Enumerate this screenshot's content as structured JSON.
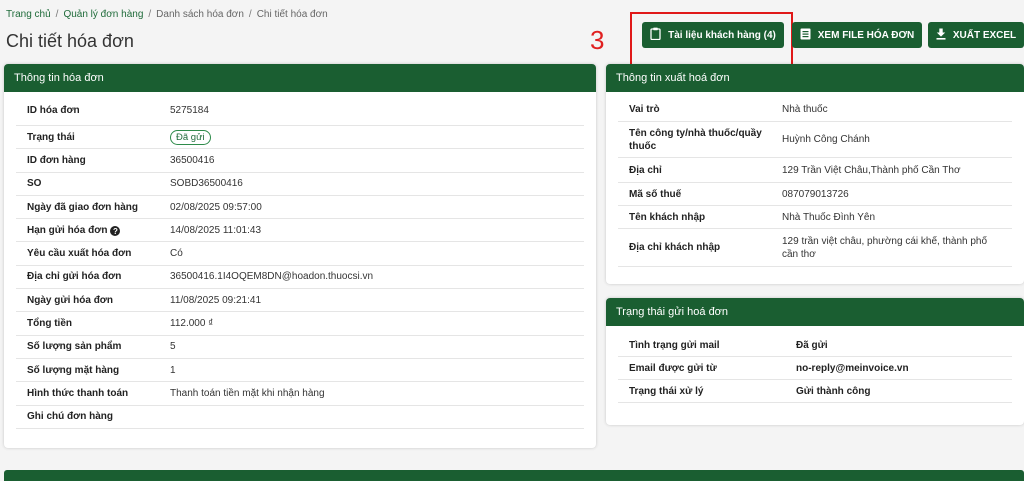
{
  "breadcrumb": [
    "Trang chủ",
    "Quản lý đơn hàng",
    "Danh sách hóa đơn",
    "Chi tiết hóa đơn"
  ],
  "page_title": "Chi tiết hóa đơn",
  "annotation": {
    "number": "3",
    "color": "#e02020"
  },
  "actions": {
    "docs_label": "Tài liệu khách hàng (4)",
    "view_label": "XEM FILE HÓA ĐƠN",
    "excel_label": "XUẤT EXCEL"
  },
  "icons": {
    "docs": "clipboard-icon",
    "view": "document-list-icon",
    "excel": "download-icon",
    "help": "question-circle-icon"
  },
  "colors": {
    "primary": "#1a5e31",
    "link": "#1f6b3a",
    "highlight": "#e01818"
  },
  "invoice_info": {
    "title": "Thông tin hóa đơn",
    "rows": [
      {
        "label": "ID hóa đơn",
        "value": "5275184"
      },
      {
        "label": "Trạng thái",
        "value": "Đã gửi"
      },
      {
        "label": "ID đơn hàng",
        "value": "36500416"
      },
      {
        "label": "SO",
        "value": "SOBD36500416"
      },
      {
        "label": "Ngày đã giao đơn hàng",
        "value": "02/08/2025 09:57:00"
      },
      {
        "label": "Hạn gửi hóa đơn",
        "value": "14/08/2025 11:01:43"
      },
      {
        "label": "Yêu cầu xuất hóa đơn",
        "value": "Có"
      },
      {
        "label": "Địa chỉ gửi hóa đơn",
        "value": "36500416.1I4OQEM8DN@hoadon.thuocsi.vn"
      },
      {
        "label": "Ngày gửi hóa đơn",
        "value": "11/08/2025 09:21:41"
      },
      {
        "label": "Tổng tiền",
        "value": "112.000 ₫"
      },
      {
        "label": "Số lượng sản phẩm",
        "value": "5"
      },
      {
        "label": "Số lượng mặt hàng",
        "value": "1"
      },
      {
        "label": "Hình thức thanh toán",
        "value": "Thanh toán tiền mặt khi nhận hàng"
      },
      {
        "label": "Ghi chú đơn hàng",
        "value": ""
      }
    ]
  },
  "issuer_info": {
    "title": "Thông tin xuất hoá đơn",
    "rows": [
      {
        "label": "Vai trò",
        "value": "Nhà thuốc"
      },
      {
        "label": "Tên công ty/nhà thuốc/quầy thuốc",
        "value": "Huỳnh Công Chánh"
      },
      {
        "label": "Địa chỉ",
        "value": "129 Trần Việt Châu,Thành phố Cần Thơ"
      },
      {
        "label": "Mã số thuế",
        "value": "087079013726"
      },
      {
        "label": "Tên khách nhập",
        "value": "Nhà Thuốc Đình Yên"
      },
      {
        "label": "Địa chỉ khách nhập",
        "value": "129 trần việt châu, phường cái khế, thành phố cần thơ"
      }
    ]
  },
  "send_status": {
    "title": "Trạng thái gửi hoá đơn",
    "rows": [
      {
        "label": "Tình trạng gửi mail",
        "value": "Đã gửi"
      },
      {
        "label": "Email được gửi từ",
        "value": "no-reply@meinvoice.vn"
      },
      {
        "label": "Trạng thái xử lý",
        "value": "Gửi thành công"
      }
    ]
  }
}
